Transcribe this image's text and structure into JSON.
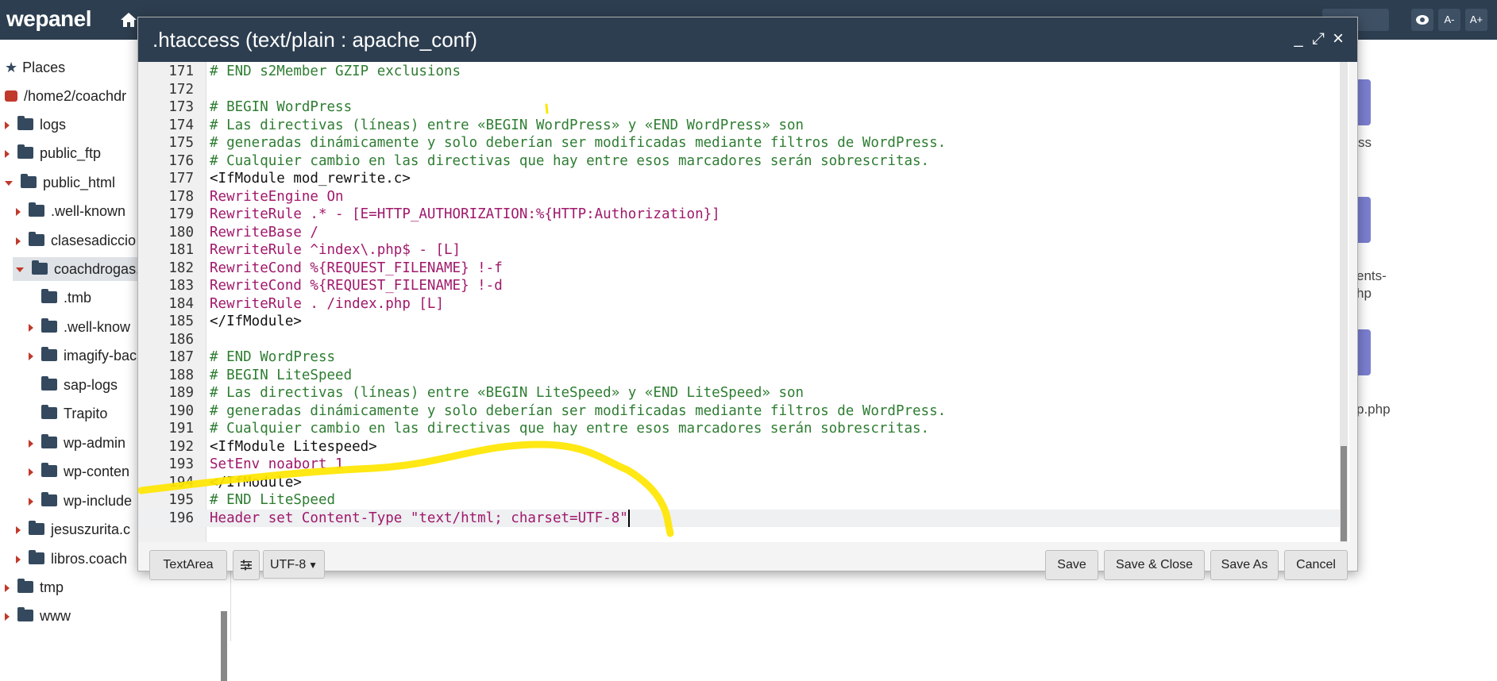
{
  "topbar": {
    "brand": "wepanel",
    "tools": [
      "A-",
      "A+"
    ]
  },
  "sidebar": {
    "items": [
      {
        "label": "Places"
      },
      {
        "label": "/home2/coachdr"
      },
      {
        "label": "logs"
      },
      {
        "label": "public_ftp"
      },
      {
        "label": "public_html"
      },
      {
        "label": ".well-known"
      },
      {
        "label": "clasesadiccio"
      },
      {
        "label": "coachdrogas."
      },
      {
        "label": ".tmb"
      },
      {
        "label": ".well-know"
      },
      {
        "label": "imagify-bac"
      },
      {
        "label": "sap-logs"
      },
      {
        "label": "Trapito"
      },
      {
        "label": "wp-admin"
      },
      {
        "label": "wp-conten"
      },
      {
        "label": "wp-include"
      },
      {
        "label": "jesuszurita.c"
      },
      {
        "label": "libros.coach"
      },
      {
        "label": "tmp"
      },
      {
        "label": "www"
      }
    ]
  },
  "background_files": [
    {
      "label": "ss"
    },
    {
      "label": "ents-"
    },
    {
      "label": "hp"
    },
    {
      "label": "p.php"
    }
  ],
  "dialog": {
    "title": ".htaccess (text/plain : apache_conf)",
    "controls": {
      "minimize": "_",
      "maximize": "⤢",
      "close": "×"
    },
    "lines": [
      {
        "n": "171",
        "text": "# END s2Member GZIP exclusions"
      },
      {
        "n": "172",
        "text": ""
      },
      {
        "n": "173",
        "text": "# BEGIN WordPress"
      },
      {
        "n": "174",
        "text": "# Las directivas (líneas) entre «BEGIN WordPress» y «END WordPress» son"
      },
      {
        "n": "175",
        "text": "# generadas dinámicamente y solo deberían ser modificadas mediante filtros de WordPress."
      },
      {
        "n": "176",
        "text": "# Cualquier cambio en las directivas que hay entre esos marcadores serán sobrescritas."
      },
      {
        "n": "177",
        "text": "<IfModule mod_rewrite.c>"
      },
      {
        "n": "178",
        "text": "RewriteEngine On"
      },
      {
        "n": "179",
        "text": "RewriteRule .* - [E=HTTP_AUTHORIZATION:%{HTTP:Authorization}]"
      },
      {
        "n": "180",
        "text": "RewriteBase /"
      },
      {
        "n": "181",
        "text": "RewriteRule ^index\\.php$ - [L]"
      },
      {
        "n": "182",
        "text": "RewriteCond %{REQUEST_FILENAME} !-f"
      },
      {
        "n": "183",
        "text": "RewriteCond %{REQUEST_FILENAME} !-d"
      },
      {
        "n": "184",
        "text": "RewriteRule . /index.php [L]"
      },
      {
        "n": "185",
        "text": "</IfModule>"
      },
      {
        "n": "186",
        "text": ""
      },
      {
        "n": "187",
        "text": "# END WordPress"
      },
      {
        "n": "188",
        "text": "# BEGIN LiteSpeed"
      },
      {
        "n": "189",
        "text": "# Las directivas (líneas) entre «BEGIN LiteSpeed» y «END LiteSpeed» son"
      },
      {
        "n": "190",
        "text": "# generadas dinámicamente y solo deberían ser modificadas mediante filtros de WordPress."
      },
      {
        "n": "191",
        "text": "# Cualquier cambio en las directivas que hay entre esos marcadores serán sobrescritas."
      },
      {
        "n": "192",
        "text": "<IfModule Litespeed>"
      },
      {
        "n": "193",
        "text": "SetEnv noabort 1"
      },
      {
        "n": "194",
        "text": "</IfModule>"
      },
      {
        "n": "195",
        "text": "# END LiteSpeed"
      },
      {
        "n": "196",
        "text": "Header set Content-Type \"text/html; charset=UTF-8\""
      }
    ],
    "footer": {
      "textarea_label": "TextArea",
      "encoding": "UTF-8",
      "save_label": "Save",
      "save_close_label": "Save & Close",
      "save_as_label": "Save As",
      "cancel_label": "Cancel"
    }
  },
  "colors": {
    "header_bg": "#2d3e50",
    "comment": "#2e7d32",
    "keyword": "#a0186b",
    "value": "#1b1b9a",
    "variable": "#2e8bb3",
    "annotation": "#ffe600"
  }
}
